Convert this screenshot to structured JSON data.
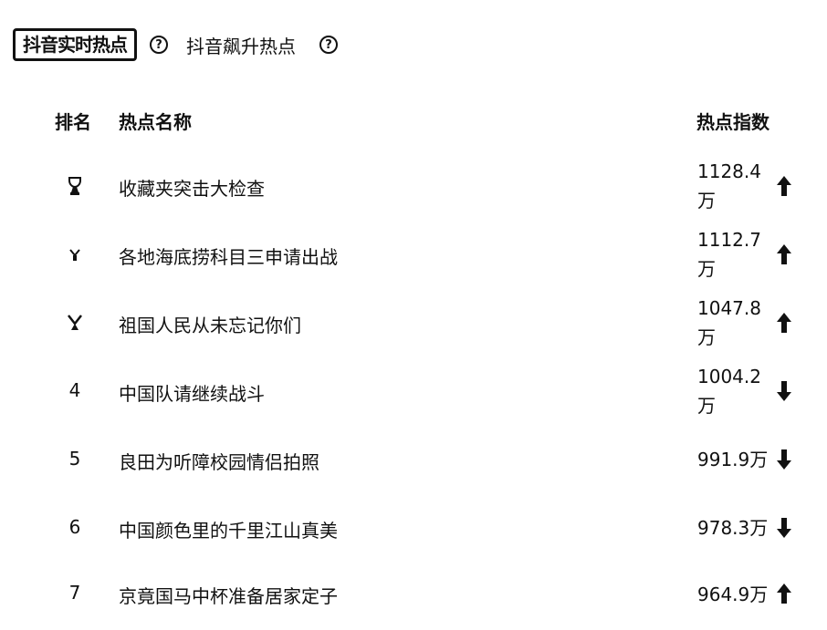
{
  "tabs": {
    "active_label": "抖音实时热点",
    "second_label": "抖音飙升热点",
    "help_symbol": "?"
  },
  "table": {
    "columns": {
      "rank": "排名",
      "name": "热点名称",
      "index": "热点指数"
    },
    "rows": [
      {
        "rank": "",
        "rank_icon": "gold-trophy-icon",
        "name": "收藏夹突击大检查",
        "value": "1128.4万",
        "trend": "up"
      },
      {
        "rank": "",
        "rank_icon": "silver-trophy-icon",
        "name": "各地海底捞科目三申请出战",
        "value": "1112.7万",
        "trend": "up"
      },
      {
        "rank": "",
        "rank_icon": "bronze-trophy-icon",
        "name": "祖国人民从未忘记你们",
        "value": "1047.8万",
        "trend": "up"
      },
      {
        "rank": "4",
        "name": "中国队请继续战斗",
        "value": "1004.2万",
        "trend": "down"
      },
      {
        "rank": "5",
        "name": "良田为听障校园情侣拍照",
        "value": "991.9万",
        "trend": "down"
      },
      {
        "rank": "6",
        "name": "中国颜色里的千里江山真美",
        "value": "978.3万",
        "trend": "down"
      },
      {
        "rank": "7",
        "name": "京竟国马中杯准备居家定子",
        "value": "964.9万",
        "trend": "up"
      }
    ]
  }
}
